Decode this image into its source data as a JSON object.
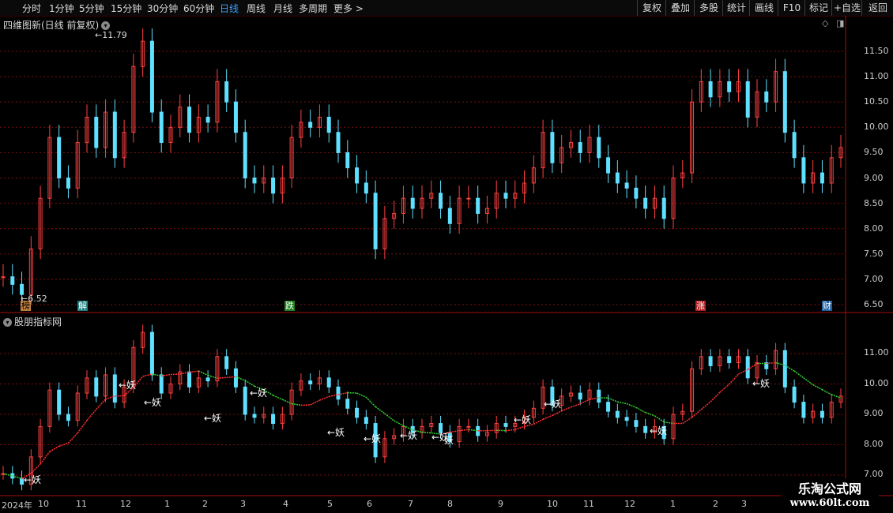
{
  "toolbar": {
    "periods": [
      "分时",
      "1分钟",
      "5分钟",
      "15分钟",
      "30分钟",
      "60分钟",
      "日线",
      "周线",
      "月线",
      "多周期",
      "更多 >"
    ],
    "active_index": 6,
    "right_buttons": [
      "复权",
      "叠加",
      "多股",
      "统计",
      "画线",
      "F10",
      "标记",
      "+自选",
      "返回"
    ]
  },
  "main_panel": {
    "title": "四维图新(日线 前复权)",
    "high_label": "11.79",
    "low_label": "6.52",
    "y_labels": [
      "11.50",
      "11.00",
      "10.50",
      "10.00",
      "9.50",
      "9.00",
      "8.50",
      "8.00",
      "7.50",
      "7.00",
      "6.50"
    ],
    "events": [
      "榜",
      "解",
      "跌",
      "涨",
      "财"
    ]
  },
  "indicator_panel": {
    "title": "股朋指标网",
    "y_labels": [
      "11.00",
      "10.00",
      "9.00",
      "8.00",
      "7.00"
    ],
    "signal_label": "←妖",
    "signal_label_2": "妖"
  },
  "x_axis": {
    "labels": [
      "2024年",
      "10",
      "11",
      "12",
      "1",
      "2",
      "3",
      "4",
      "5",
      "6",
      "7",
      "8",
      "9",
      "10",
      "11",
      "12",
      "1",
      "2",
      "3"
    ]
  },
  "watermark": {
    "line1": "乐淘公式网",
    "line2": "www.60lt.com"
  },
  "colors": {
    "up": "#ff4040",
    "down": "#5fe0ff",
    "grid": "#7a1010",
    "ma_down": "#30d030",
    "ma_up": "#ff3030"
  },
  "chart_data": {
    "type": "candlestick",
    "title": "四维图新(日线 前复权)",
    "y_range": [
      6.3,
      12.0
    ],
    "max_price": 11.79,
    "min_price": 6.52,
    "series": [
      {
        "name": "close",
        "values": [
          7.05,
          6.9,
          6.7,
          7.6,
          8.6,
          9.8,
          9.0,
          8.8,
          9.7,
          10.2,
          9.6,
          10.3,
          9.4,
          9.9,
          11.2,
          11.7,
          10.3,
          9.7,
          10.0,
          10.4,
          9.9,
          10.2,
          10.1,
          10.9,
          10.5,
          9.9,
          9.0,
          8.9,
          9.0,
          8.7,
          9.0,
          9.8,
          10.1,
          10.0,
          10.2,
          9.9,
          9.5,
          9.2,
          8.9,
          8.7,
          7.6,
          8.2,
          8.3,
          8.6,
          8.4,
          8.6,
          8.7,
          8.4,
          8.1,
          8.6,
          8.6,
          8.3,
          8.4,
          8.7,
          8.6,
          8.7,
          8.9,
          9.2,
          9.9,
          9.3,
          9.6,
          9.7,
          9.5,
          9.8,
          9.4,
          9.1,
          8.9,
          8.8,
          8.6,
          8.4,
          8.6,
          8.2,
          9.0,
          9.1,
          10.5,
          10.9,
          10.6,
          10.9,
          10.7,
          10.9,
          10.2,
          10.7,
          10.5,
          11.1,
          9.9,
          9.4,
          8.9,
          9.1,
          8.9,
          9.4,
          9.6
        ]
      }
    ]
  }
}
